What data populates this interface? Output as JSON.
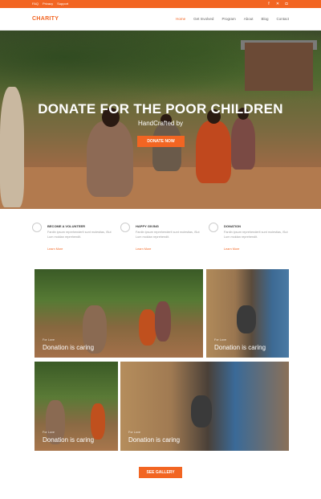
{
  "topbar": {
    "links": [
      "FAQ",
      "Privacy",
      "Support"
    ],
    "social_icons": [
      "facebook-icon",
      "twitter-icon",
      "instagram-icon"
    ]
  },
  "nav": {
    "logo": "CHARITY",
    "items": [
      "Home",
      "Get Involved",
      "Program",
      "About",
      "Blog",
      "Contact"
    ],
    "active_index": 0
  },
  "hero": {
    "title": "DONATE FOR THE POOR CHILDREN",
    "subtitle": "HandCrafted by",
    "button": "DONATE NOW"
  },
  "features": [
    {
      "title": "BECOME A VOLUNTEER",
      "text": "Fardin ipsum reprehenderit sunt molestias, iSut Lum moldan reprehendit.",
      "link": "Learn More"
    },
    {
      "title": "HAPPY GIVING",
      "text": "Fardin ipsum reprehenderit sunt molestias, iSut Lum moldan reprehendit.",
      "link": "Learn More"
    },
    {
      "title": "DONATION",
      "text": "Fardin ipsum reprehenderit sunt molestias, iSut Lum moldan reprehendit.",
      "link": "Learn More"
    }
  ],
  "gallery": [
    {
      "small": "For Love",
      "caption": "Donation is caring"
    },
    {
      "small": "For Love",
      "caption": "Donation is caring"
    },
    {
      "small": "For Love",
      "caption": "Donation is caring"
    },
    {
      "small": "For Love",
      "caption": "Donation is caring"
    }
  ],
  "see_gallery": "SEE GALLERY",
  "colors": {
    "accent": "#f26522"
  }
}
